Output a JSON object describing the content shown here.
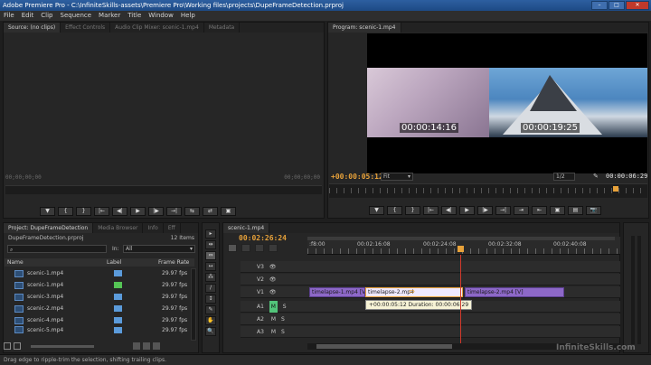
{
  "app": {
    "title": "Adobe Premiere Pro - C:\\InfiniteSkills-assets\\Premiere Pro\\Working files\\projects\\DupeFrameDetection.prproj",
    "window_buttons": [
      "–",
      "□",
      "✕"
    ]
  },
  "menu": [
    "File",
    "Edit",
    "Clip",
    "Sequence",
    "Marker",
    "Title",
    "Window",
    "Help"
  ],
  "source_panel": {
    "tabs": [
      "Source: (no clips)",
      "Effect Controls",
      "Audio Clip Mixer: scenic-1.mp4",
      "Metadata"
    ],
    "timecode_left": "00;00;00;00",
    "timecode_right": "00;00;00;00",
    "controls": [
      "▼",
      "{",
      "}",
      "|←",
      "◀|",
      "▶",
      "|▶",
      "→|",
      "⇆",
      "⇄",
      "▣"
    ]
  },
  "program_panel": {
    "tab": "Program: scenic-1.mp4",
    "overlay_tc_left": "00:00:14:16",
    "overlay_tc_right": "00:00:19:25",
    "timecode_current": "+00:00:05:12",
    "fit": "Fit",
    "resolution": "1/2",
    "timecode_duration": "00:00:06:29",
    "playhead_fraction": 0.9,
    "controls": [
      "▼",
      "{",
      "}",
      "|←",
      "◀|",
      "▶",
      "|▶",
      "→|",
      "⇥",
      "⇤",
      "▣",
      "▤",
      "📷"
    ]
  },
  "project_panel": {
    "tabs": [
      "Project: DupeFrameDetection",
      "Media Browser",
      "Info",
      "Eff"
    ],
    "filename": "DupeFrameDetection.prproj",
    "item_count": "12 Items",
    "in_label": "In:",
    "in_value": "All",
    "columns": [
      "Name",
      "Label",
      "Frame Rate"
    ],
    "items": [
      {
        "name": "scenic-1.mp4",
        "label_color": "blue",
        "frame_rate": "29.97 fps"
      },
      {
        "name": "scenic-1.mp4",
        "label_color": "green",
        "frame_rate": "29.97 fps"
      },
      {
        "name": "scenic-3.mp4",
        "label_color": "blue",
        "frame_rate": "29.97 fps"
      },
      {
        "name": "scenic-2.mp4",
        "label_color": "blue",
        "frame_rate": "29.97 fps"
      },
      {
        "name": "scenic-4.mp4",
        "label_color": "blue",
        "frame_rate": "29.97 fps"
      },
      {
        "name": "scenic-5.mp4",
        "label_color": "blue",
        "frame_rate": "29.97 fps"
      }
    ]
  },
  "tools": [
    "▸",
    "⇹",
    "⇔",
    "↔",
    "⁂",
    "∕",
    "↕",
    "✎",
    "✋",
    "🔍"
  ],
  "timeline": {
    "tab": "scenic-1.mp4",
    "timecode": "00:02:26:24",
    "ruler_labels": [
      ":f8:00",
      "00:02:16:08",
      "00:02:24:08",
      "00:02:32:08",
      "00:02:40:08"
    ],
    "tracks": {
      "video": [
        "V3",
        "V2",
        "V1"
      ],
      "audio": [
        "A1",
        "A2",
        "A3"
      ]
    },
    "clips": [
      {
        "name": "timelapse-1.mp4 [V]"
      },
      {
        "name": "timelapse-2.mp4"
      },
      {
        "name": "timelapse-2.mp4 [V]"
      }
    ],
    "tooltip": "+00:00:05:12 Duration: 00:00:06:29",
    "track_btns": [
      "M",
      "S"
    ]
  },
  "status": "Drag edge to ripple-trim the selection, shifting trailing clips.",
  "watermark": "InfiniteSkills.com"
}
